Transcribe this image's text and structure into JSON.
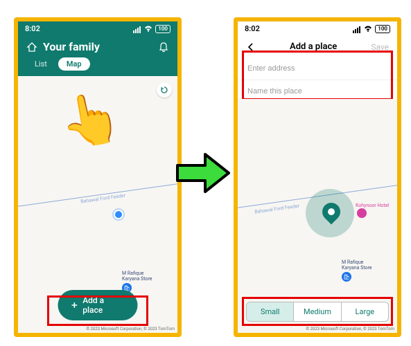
{
  "status": {
    "time": "8:02",
    "battery": "100"
  },
  "screen1": {
    "title": "Your family",
    "tabs": {
      "list": "List",
      "map": "Map"
    },
    "road": "Bahawal Ford Feeder",
    "poi1_line1": "M Rafique",
    "poi1_line2": "Karyana Store",
    "add_button": "Add a place",
    "attribution": "© 2023 Microsoft Corporation, © 2023 TomTom"
  },
  "screen2": {
    "nav_title": "Add a place",
    "save": "Save",
    "address_placeholder": "Enter address",
    "name_placeholder": "Name this place",
    "road": "Bahawal Ford Feeder",
    "poi_hotel": "Kohynoor Hotel",
    "poi1_line1": "M Rafique",
    "poi1_line2": "Karyana Store",
    "sizes": {
      "small": "Small",
      "medium": "Medium",
      "large": "Large"
    },
    "attribution": "© 2023 Microsoft Corporation, © 2023 TomTom"
  }
}
